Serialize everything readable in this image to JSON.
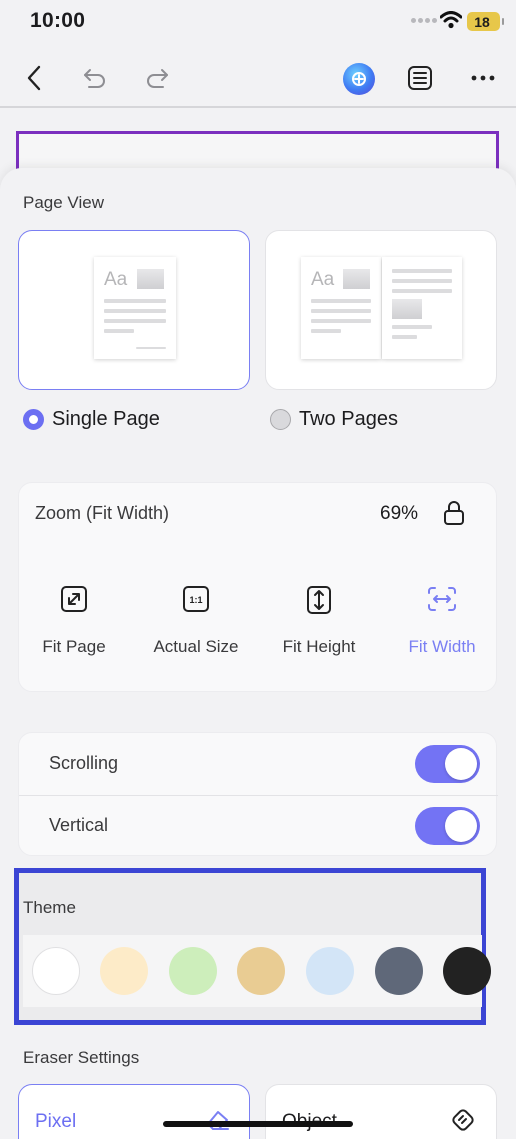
{
  "status": {
    "time": "10:00",
    "battery": "18"
  },
  "toolbar": {
    "icons": [
      "back-icon",
      "undo-icon",
      "redo-icon",
      "ai-assistant-icon",
      "list-icon",
      "more-icon"
    ]
  },
  "page_view": {
    "title": "Page View",
    "options": [
      {
        "label": "Single Page",
        "selected": true,
        "thumb_text": "Aa"
      },
      {
        "label": "Two Pages",
        "selected": false,
        "thumb_text": "Aa"
      }
    ]
  },
  "zoom": {
    "title": "Zoom (Fit Width)",
    "value": "69%",
    "options": [
      {
        "label": "Fit Page",
        "icon": "fit-page-icon",
        "active": false
      },
      {
        "label": "Actual Size",
        "icon": "actual-size-icon",
        "icon_text": "1:1",
        "active": false
      },
      {
        "label": "Fit Height",
        "icon": "fit-height-icon",
        "active": false
      },
      {
        "label": "Fit Width",
        "icon": "fit-width-icon",
        "active": true
      }
    ]
  },
  "toggles": [
    {
      "label": "Scrolling",
      "on": true
    },
    {
      "label": "Vertical",
      "on": true
    }
  ],
  "theme": {
    "title": "Theme",
    "swatches": [
      "#ffffff",
      "#fdebc8",
      "#cdeebb",
      "#e9cc93",
      "#d3e5f7",
      "#5f6879",
      "#222222"
    ]
  },
  "eraser": {
    "title": "Eraser Settings",
    "options": [
      {
        "label": "Pixel",
        "selected": true,
        "icon": "eraser-icon"
      },
      {
        "label": "Object",
        "selected": false,
        "icon": "object-eraser-icon"
      }
    ]
  },
  "colors": {
    "accent": "#6c6ff2",
    "highlight": "#3b45d4"
  }
}
